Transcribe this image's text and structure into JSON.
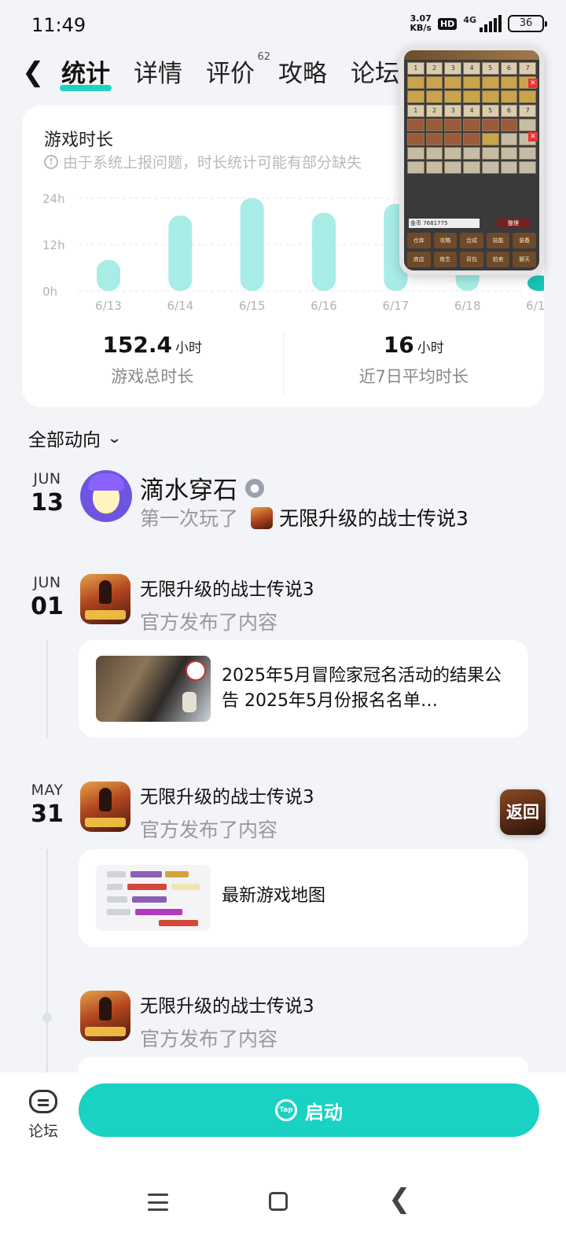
{
  "status": {
    "time": "11:49",
    "net_speed_value": "3.07",
    "net_speed_unit": "KB/s",
    "hd": "HD",
    "network": "4G",
    "battery": "36"
  },
  "nav": {
    "tabs": [
      {
        "label": "统计"
      },
      {
        "label": "详情"
      },
      {
        "label": "评价",
        "badge": "62"
      },
      {
        "label": "攻略"
      },
      {
        "label": "论坛"
      }
    ]
  },
  "stats": {
    "title": "游戏时长",
    "note": "由于系统上报问题，时长统计可能有部分缺失",
    "total_value": "152.4",
    "total_unit": "小时",
    "total_label": "游戏总时长",
    "avg_value": "16",
    "avg_unit": "小时",
    "avg_label": "近7日平均时长"
  },
  "chart_data": {
    "type": "bar",
    "categories": [
      "6/13",
      "6/14",
      "6/15",
      "6/16",
      "6/17",
      "6/18",
      "6/19"
    ],
    "values": [
      8,
      19.5,
      24,
      20.2,
      22.5,
      19,
      4
    ],
    "highlight_index": 6,
    "ylim": [
      0,
      24
    ],
    "yticks": [
      "0h",
      "12h",
      "24h"
    ],
    "bar_color": "#a8ece6",
    "highlight_color": "#19c3b6",
    "grid": true
  },
  "pip": {
    "slots_row1": [
      "1",
      "2",
      "3",
      "4",
      "5",
      "6",
      "7"
    ],
    "slots_row2": [
      "1",
      "2",
      "3",
      "4",
      "5",
      "6",
      "7"
    ],
    "gold": "金币 7681775",
    "sort": "整理",
    "buttons": [
      "仓库",
      "攻略",
      "合成",
      "技能",
      "装备",
      "商店",
      "练生",
      "背包",
      "拍卖",
      "聊天"
    ]
  },
  "feed": {
    "filter_label": "全部动向",
    "entries": [
      {
        "month": "JUN",
        "day": "13",
        "user_name": "滴水穿石",
        "played_prefix": "第一次玩了",
        "game_name": "无限升级的战士传说3"
      },
      {
        "month": "JUN",
        "day": "01",
        "title": "无限升级的战士传说3",
        "subtitle": "官方发布了内容",
        "card_text": "2025年5月冒险家冠名活动的结果公告 2025年5月份报名名单…"
      },
      {
        "month": "MAY",
        "day": "31",
        "title": "无限升级的战士传说3",
        "subtitle": "官方发布了内容",
        "card_text": "最新游戏地图"
      },
      {
        "title": "无限升级的战士传说3",
        "subtitle": "官方发布了内容"
      }
    ]
  },
  "float_return": "返回",
  "actions": {
    "forum_label": "论坛",
    "launch_label": "启动",
    "tap_icon": "Tap"
  }
}
